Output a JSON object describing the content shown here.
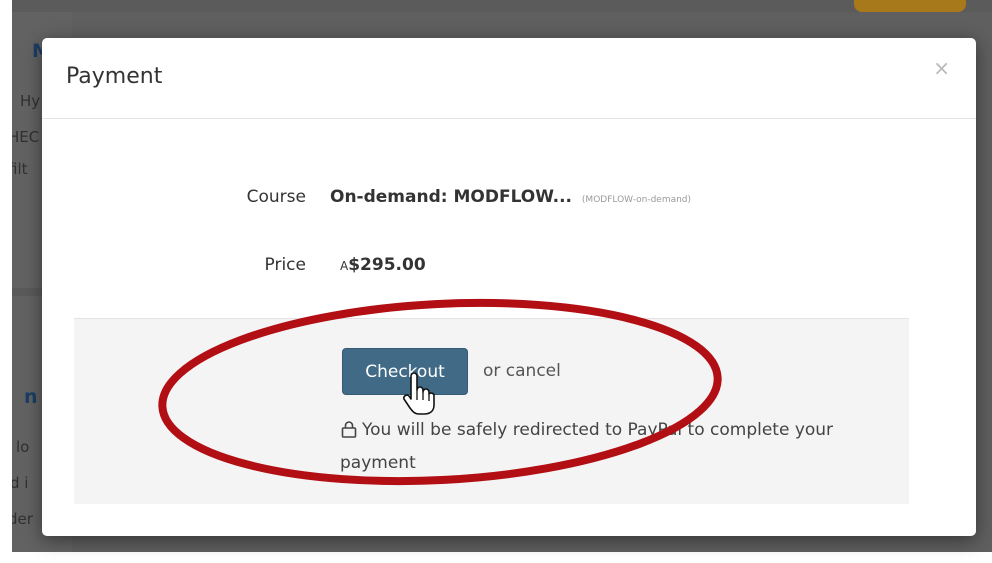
{
  "background": {
    "snippets": [
      "M",
      "Hy",
      "HEC",
      "filt",
      "n",
      "lo",
      "d i",
      "der"
    ]
  },
  "modal": {
    "title": "Payment",
    "close_label": "×",
    "course": {
      "label": "Course",
      "value": "On-demand: MODFLOW...",
      "code": "(MODFLOW-on-demand)"
    },
    "price": {
      "label": "Price",
      "currency_prefix": "A",
      "amount": "$295.00"
    },
    "checkout": {
      "button_label": "Checkout",
      "cancel_text": "or cancel",
      "redirect_note": "You will be safely redirected to PayPal to complete your payment"
    }
  },
  "icons": {
    "lock": "lock-icon",
    "cursor": "hand-pointer-icon",
    "close": "close-icon"
  },
  "colors": {
    "checkout_button": "#406a86",
    "annotation": "#b20f14",
    "overlay": "#5f5f5f"
  }
}
